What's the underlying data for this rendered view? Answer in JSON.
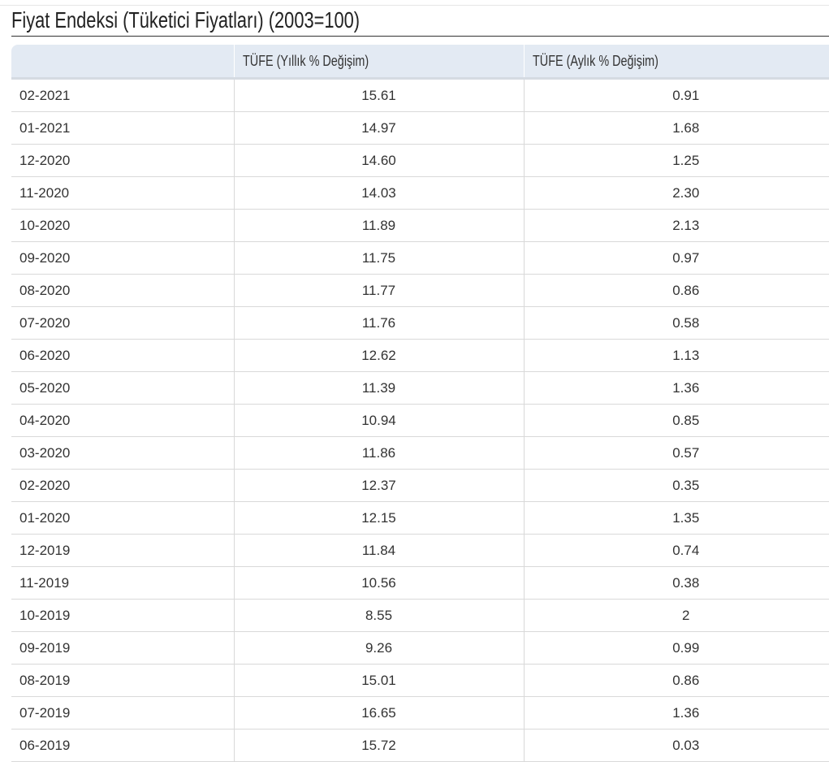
{
  "title": "Fiyat Endeksi (Tüketici Fiyatları) (2003=100)",
  "table": {
    "headers": [
      "",
      "TÜFE (Yıllık % Değişim)",
      "TÜFE (Aylık % Değişim)"
    ],
    "rows": [
      [
        "02-2021",
        "15.61",
        "0.91"
      ],
      [
        "01-2021",
        "14.97",
        "1.68"
      ],
      [
        "12-2020",
        "14.60",
        "1.25"
      ],
      [
        "11-2020",
        "14.03",
        "2.30"
      ],
      [
        "10-2020",
        "11.89",
        "2.13"
      ],
      [
        "09-2020",
        "11.75",
        "0.97"
      ],
      [
        "08-2020",
        "11.77",
        "0.86"
      ],
      [
        "07-2020",
        "11.76",
        "0.58"
      ],
      [
        "06-2020",
        "12.62",
        "1.13"
      ],
      [
        "05-2020",
        "11.39",
        "1.36"
      ],
      [
        "04-2020",
        "10.94",
        "0.85"
      ],
      [
        "03-2020",
        "11.86",
        "0.57"
      ],
      [
        "02-2020",
        "12.37",
        "0.35"
      ],
      [
        "01-2020",
        "12.15",
        "1.35"
      ],
      [
        "12-2019",
        "11.84",
        "0.74"
      ],
      [
        "11-2019",
        "10.56",
        "0.38"
      ],
      [
        "10-2019",
        "8.55",
        "2"
      ],
      [
        "09-2019",
        "9.26",
        "0.99"
      ],
      [
        "08-2019",
        "15.01",
        "0.86"
      ],
      [
        "07-2019",
        "16.65",
        "1.36"
      ],
      [
        "06-2019",
        "15.72",
        "0.03"
      ]
    ]
  }
}
